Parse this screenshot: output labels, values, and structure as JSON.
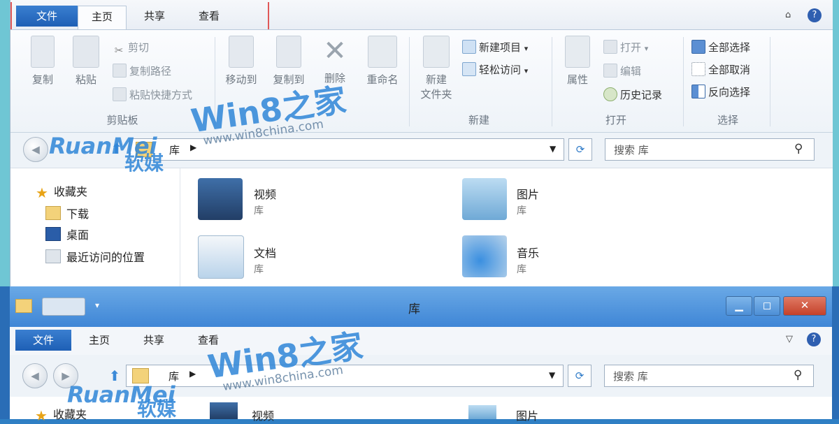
{
  "top": {
    "tabs": {
      "file": "文件",
      "home": "主页",
      "share": "共享",
      "view": "查看"
    },
    "ribbon": {
      "clipboard": {
        "group_label": "剪贴板",
        "copy": "复制",
        "paste": "粘贴",
        "cut": "剪切",
        "copy_path": "复制路径",
        "paste_shortcut": "粘贴快捷方式"
      },
      "organize": {
        "move_to": "移动到",
        "copy_to": "复制到",
        "delete": "删除",
        "rename": "重命名"
      },
      "new": {
        "group_label": "新建",
        "new_folder_line1": "新建",
        "new_folder_line2": "文件夹",
        "new_item": "新建项目",
        "easy_access": "轻松访问"
      },
      "open": {
        "group_label": "打开",
        "properties": "属性",
        "open": "打开",
        "edit": "编辑",
        "history": "历史记录"
      },
      "select": {
        "group_label": "选择",
        "select_all": "全部选择",
        "select_none": "全部取消",
        "invert": "反向选择"
      }
    },
    "address": {
      "crumb": "库"
    },
    "search": {
      "placeholder": "搜索 库"
    },
    "nav": {
      "favorites": "收藏夹",
      "downloads": "下载",
      "desktop": "桌面",
      "recent": "最近访问的位置"
    },
    "libraries": [
      {
        "name": "视频",
        "sub": "库"
      },
      {
        "name": "图片",
        "sub": "库"
      },
      {
        "name": "文档",
        "sub": "库"
      },
      {
        "name": "音乐",
        "sub": "库"
      }
    ]
  },
  "bottom": {
    "title": "库",
    "tabs": {
      "file": "文件",
      "home": "主页",
      "share": "共享",
      "view": "查看"
    },
    "address": {
      "crumb": "库"
    },
    "search": {
      "placeholder": "搜索 库"
    },
    "nav": {
      "favorites": "收藏夹"
    },
    "libraries": [
      {
        "name": "视频"
      },
      {
        "name": "图片"
      }
    ]
  },
  "watermark": {
    "brand_en": "RuanMei",
    "brand_cn": "软媒",
    "site_name": "Win8之家",
    "site_url": "www.win8china.com"
  },
  "colors": {
    "accent": "#1e5fb5",
    "highlight_outline": "#e05858",
    "panel_bg": "#f3f6fa"
  }
}
